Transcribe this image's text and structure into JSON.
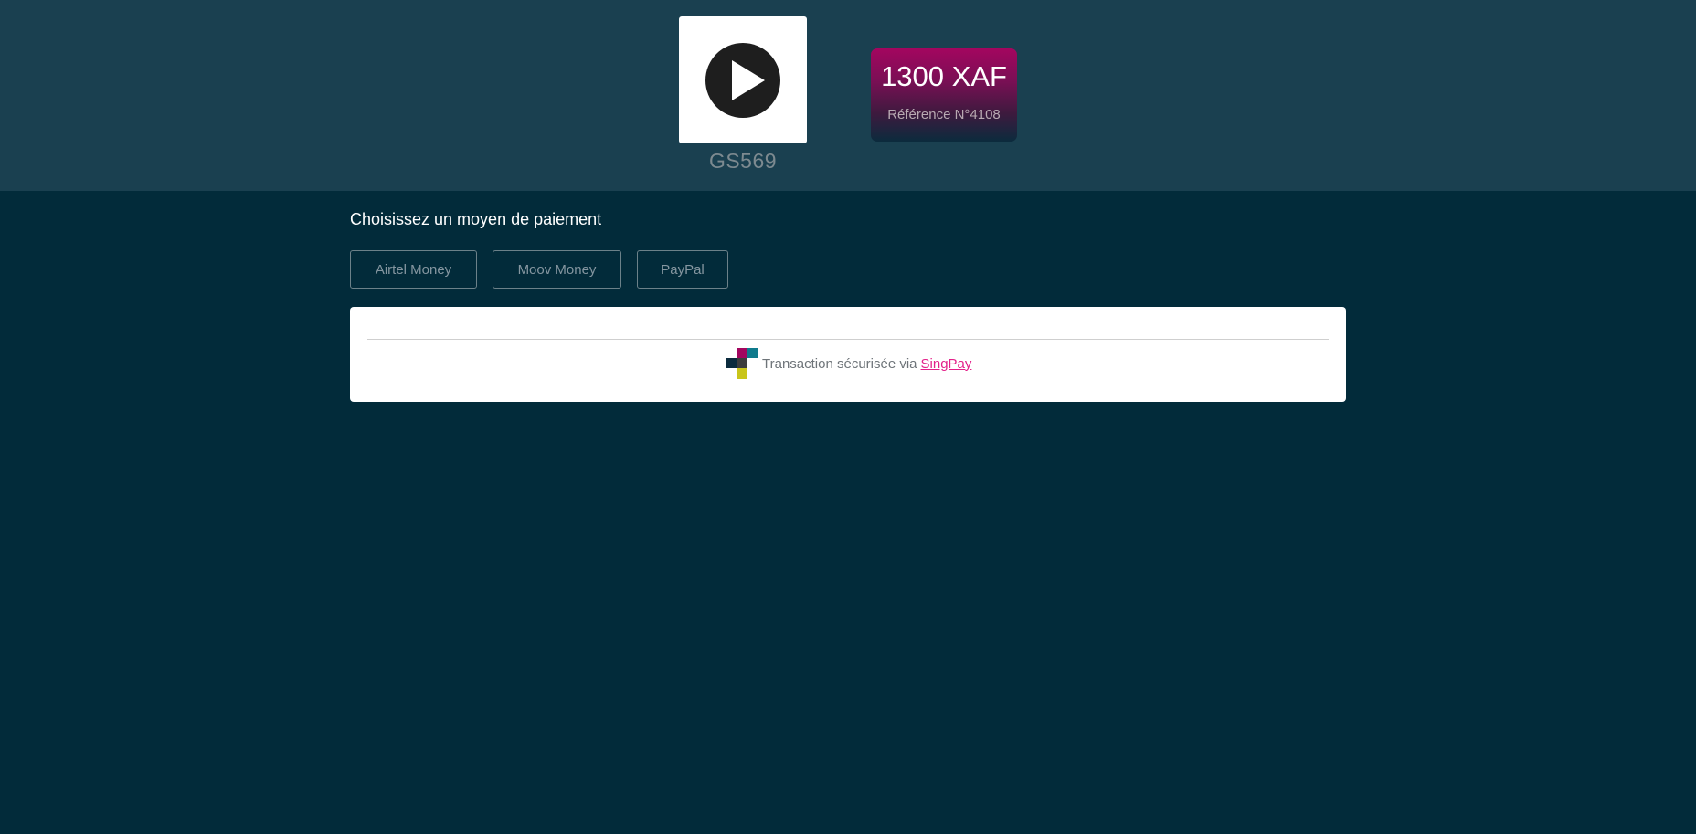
{
  "merchant": {
    "logo_icon": "play-button-icon",
    "name": "GS569"
  },
  "payment": {
    "amount": "1300 XAF",
    "reference": "Référence N°4108"
  },
  "methods": {
    "title": "Choisissez un moyen de paiement",
    "options": [
      {
        "label": "Airtel Money"
      },
      {
        "label": "Moov Money"
      },
      {
        "label": "PayPal"
      }
    ]
  },
  "footer": {
    "secure_text": "Transaction sécurisée via",
    "provider_link": "SingPay",
    "provider_icon": "singpay-logo-icon"
  },
  "colors": {
    "background": "#022b3a",
    "header": "#1a4050",
    "accent": "#e3218a",
    "card_gradient_top": "#a3065f"
  }
}
